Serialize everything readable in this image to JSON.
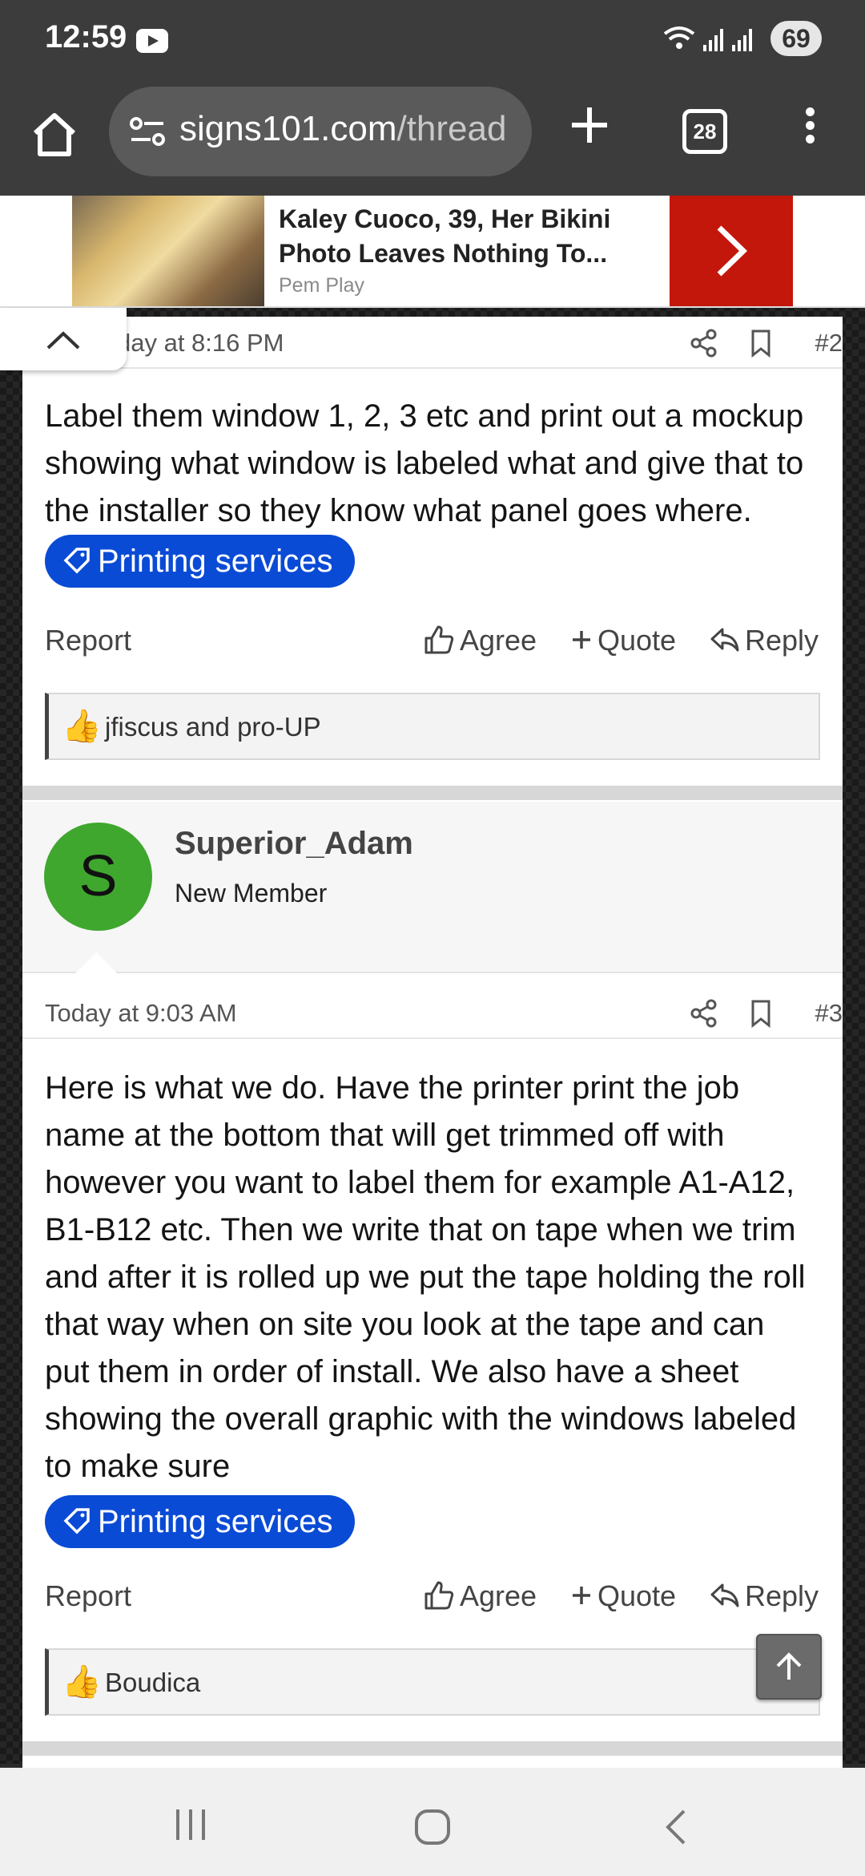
{
  "status_bar": {
    "time": "12:59",
    "battery": "69",
    "icons": [
      "youtube-icon",
      "wifi-icon",
      "signal-icon",
      "signal-icon"
    ]
  },
  "browser": {
    "url_domain": "signs101.com",
    "url_path": "/thread",
    "tab_count": "28"
  },
  "ad": {
    "title": "Kaley Cuoco, 39, Her Bikini Photo Leaves Nothing To...",
    "source": "Pem Play",
    "accent": "#c4170c"
  },
  "posts": [
    {
      "date": "day at 8:16 PM",
      "number": "#2",
      "body": "Label them window 1, 2, 3 etc and print out a mockup showing what window is labeled what and give that to the installer so they know what panel goes where.",
      "tag": "Printing services",
      "reactions": "jfiscus and pro-UP"
    },
    {
      "author": "Superior_Adam",
      "author_title": "New Member",
      "avatar_letter": "S",
      "avatar_color": "#3fa72e",
      "date": "Today at 9:03 AM",
      "number": "#3",
      "body": "Here is what we do. Have the printer print the job name at the bottom that will get trimmed off with however you want to label them for example A1-A12, B1-B12 etc. Then we write that on tape when we trim and after it is rolled up we put the tape holding the roll that way when on site you look at the tape and can put them in order of install. We also have a sheet showing the overall graphic with the windows labeled to make sure",
      "tag": "Printing services",
      "reactions": "Boudica"
    }
  ],
  "actions": {
    "report": "Report",
    "agree": "Agree",
    "quote": "Quote",
    "reply": "Reply"
  },
  "tag_color": "#0a4bd6"
}
